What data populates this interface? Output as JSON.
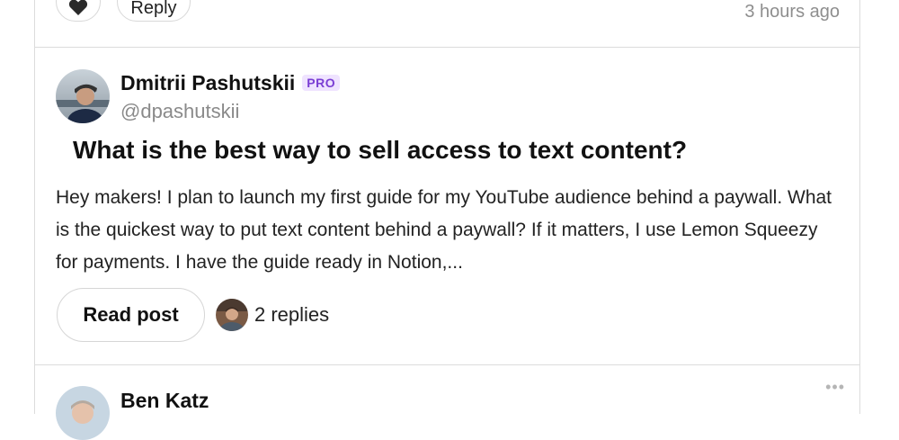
{
  "previous_post": {
    "reply_label": "Reply",
    "time": "3 hours ago",
    "like_icon": "heart-icon"
  },
  "post": {
    "author": {
      "name": "Dmitrii Pashutskii",
      "badge": "PRO",
      "handle": "@dpashutskii"
    },
    "title": "What is the best way to sell access to text content?",
    "body": "Hey makers! I plan to launch my first guide for my YouTube audience behind a paywall. What is the quickest way to put text content behind a paywall? If it matters, I use Lemon Squeezy for payments. I have the guide ready in Notion,...",
    "read_button": "Read post",
    "replies_label": "2 replies"
  },
  "next_post": {
    "author": {
      "name": "Ben Katz"
    },
    "more_icon": "more-dots-icon"
  },
  "colors": {
    "badge_text": "#7b3fd4",
    "badge_bg": "#efe3ff",
    "muted": "#8a8a8a",
    "border": "#dcdcdc"
  }
}
